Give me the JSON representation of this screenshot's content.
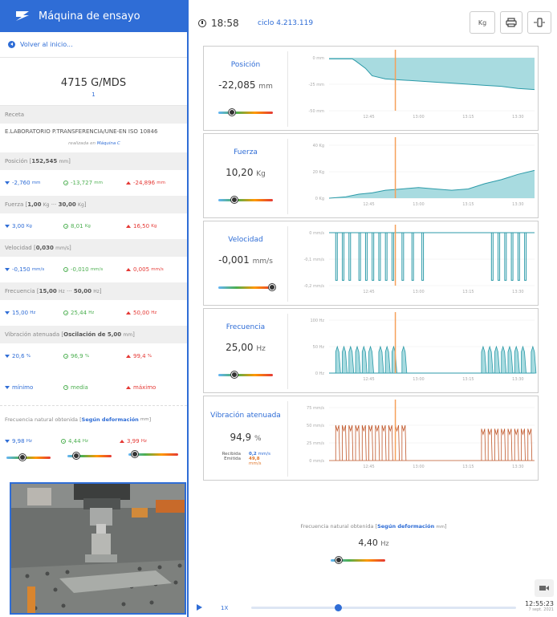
{
  "app": {
    "title": "Máquina de ensayo",
    "back_label": "Volver al inicio..."
  },
  "machine": {
    "code": "4715 G/MDS",
    "sub": "1"
  },
  "recipe": {
    "header": "Receta",
    "name": "E.LABORATORIO P.TRANSFERENCIA/UNE-EN ISO 10846",
    "realized_prefix": "realizada en",
    "realized_on": "Máquina C"
  },
  "sections": [
    {
      "label": "Posición",
      "range_prefix": "[",
      "range_value": "152,545",
      "range_unit": "mm",
      "range_suffix": "]",
      "min": "-2,760",
      "min_u": "mm",
      "mean": "-13,727",
      "mean_u": "mm",
      "max": "-24,896",
      "max_u": "mm"
    },
    {
      "label": "Fuerza",
      "range_prefix": "[",
      "range_value": "1,00",
      "range_unit": "Kg",
      "range_mid": "···",
      "range_value2": "30,00",
      "range_unit2": "Kg",
      "range_suffix": "]",
      "min": "3,00",
      "min_u": "Kg",
      "mean": "8,01",
      "mean_u": "Kg",
      "max": "16,50",
      "max_u": "Kg"
    },
    {
      "label": "Velocidad",
      "range_prefix": "[",
      "range_value": "0,030",
      "range_unit": "mm/s",
      "range_suffix": "]",
      "min": "-0,150",
      "min_u": "mm/s",
      "mean": "-0,010",
      "mean_u": "mm/s",
      "max": "0,005",
      "max_u": "mm/s"
    },
    {
      "label": "Frecuencia",
      "range_prefix": "[",
      "range_value": "15,00",
      "range_unit": "Hz",
      "range_mid": "···",
      "range_value2": "50,00",
      "range_unit2": "Hz",
      "range_suffix": "]",
      "min": "15,00",
      "min_u": "Hz",
      "mean": "25,44",
      "mean_u": "Hz",
      "max": "50,00",
      "max_u": "Hz"
    },
    {
      "label": "Vibración atenuada",
      "range_prefix": "[",
      "range_value": "Oscilación de 5,00",
      "range_unit": "mm",
      "range_suffix": "]",
      "min": "20,6",
      "min_u": "%",
      "mean": "96,9",
      "mean_u": "%",
      "max": "99,4",
      "max_u": "%"
    }
  ],
  "legend": {
    "min": "mínimo",
    "mean": "media",
    "max": "máximo"
  },
  "natural": {
    "label": "Frecuencia natural obtenida",
    "open": "[",
    "bold": "Según deformación",
    "unit": "mm",
    "close": "]",
    "min": "9,98",
    "min_u": "Hz",
    "mean": "4,44",
    "mean_u": "Hz",
    "max": "3,99",
    "max_u": "Hz",
    "value": "4,40",
    "value_u": "Hz"
  },
  "top": {
    "time": "18:58",
    "cycle": "ciclo 4.213.119",
    "unit_btn": "Kg"
  },
  "cards": [
    {
      "label": "Posición",
      "value": "-22,085",
      "unit": "mm",
      "slider": 0.25
    },
    {
      "label": "Fuerza",
      "value": "10,20",
      "unit": "Kg",
      "slider": 0.3
    },
    {
      "label": "Velocidad",
      "value": "-0,001",
      "unit": "mm/s",
      "slider": 0.98
    },
    {
      "label": "Frecuencia",
      "value": "25,00",
      "unit": "Hz",
      "slider": 0.3
    },
    {
      "label": "Vibración atenuada",
      "value": "94,9",
      "unit": "%",
      "rec_label": "Recibida",
      "rec_value": "0,2",
      "rec_unit": "mm/s",
      "emi_label": "Emitida",
      "emi_value": "49,8",
      "emi_unit": "mm/s"
    }
  ],
  "chart_data": [
    {
      "type": "area",
      "title": "",
      "ytick_labels": [
        "0 mm",
        "-25 mm",
        "-50 mm"
      ],
      "ylim": [
        -50,
        0
      ],
      "xtick_labels": [
        "12:45",
        "13:00",
        "13:15",
        "13:30"
      ],
      "marker_x": "12:53",
      "x": [
        "12:33",
        "12:37",
        "12:40",
        "12:41",
        "12:44",
        "12:46",
        "12:50",
        "12:55",
        "13:00",
        "13:05",
        "13:10",
        "13:15",
        "13:20",
        "13:25",
        "13:30",
        "13:35"
      ],
      "y": [
        -1,
        -1,
        -1,
        -3,
        -10,
        -17,
        -20,
        -21,
        -22,
        -23,
        -24,
        -25,
        -26,
        -27,
        -29,
        -30
      ]
    },
    {
      "type": "area",
      "title": "",
      "ytick_labels": [
        "40 Kg",
        "20 Kg",
        "0 Kg"
      ],
      "ylim": [
        0,
        40
      ],
      "xtick_labels": [
        "12:45",
        "13:00",
        "13:15",
        "13:30"
      ],
      "marker_x": "12:53",
      "x": [
        "12:33",
        "12:38",
        "12:42",
        "12:46",
        "12:50",
        "12:55",
        "13:00",
        "13:05",
        "13:10",
        "13:15",
        "13:20",
        "13:25",
        "13:30",
        "13:35"
      ],
      "y": [
        0,
        1,
        3,
        4,
        6,
        7,
        8,
        7,
        6,
        7,
        11,
        14,
        18,
        21
      ]
    },
    {
      "type": "line",
      "title": "",
      "ytick_labels": [
        "0 mm/s",
        "-0,1 mm/s",
        "-0,2 mm/s"
      ],
      "ylim": [
        -0.2,
        0
      ],
      "xtick_labels": [
        "12:45",
        "13:00",
        "13:15",
        "13:30"
      ],
      "marker_x": "12:53"
    },
    {
      "type": "area",
      "title": "",
      "ytick_labels": [
        "100 Hz",
        "50 Hz",
        "0 Hz"
      ],
      "ylim": [
        0,
        100
      ],
      "xtick_labels": [
        "12:45",
        "13:00",
        "13:15",
        "13:30"
      ],
      "marker_x": "12:53"
    },
    {
      "type": "line",
      "title": "",
      "ytick_labels": [
        "75 mm/s",
        "50 mm/s",
        "25 mm/s",
        "0 mm/s"
      ],
      "ylim": [
        0,
        75
      ],
      "xtick_labels": [
        "12:45",
        "13:00",
        "13:15",
        "13:30"
      ],
      "marker_x": "12:53"
    }
  ],
  "player": {
    "speed": "1X",
    "time": "12:55:23",
    "date": "7 sept. 2021",
    "progress": 0.33
  },
  "colors": {
    "accent": "#2f6dd6",
    "area": "#a8dbe0",
    "line": "#2b9aa8",
    "marker": "#f5a05a",
    "vib": "#c0572a"
  }
}
